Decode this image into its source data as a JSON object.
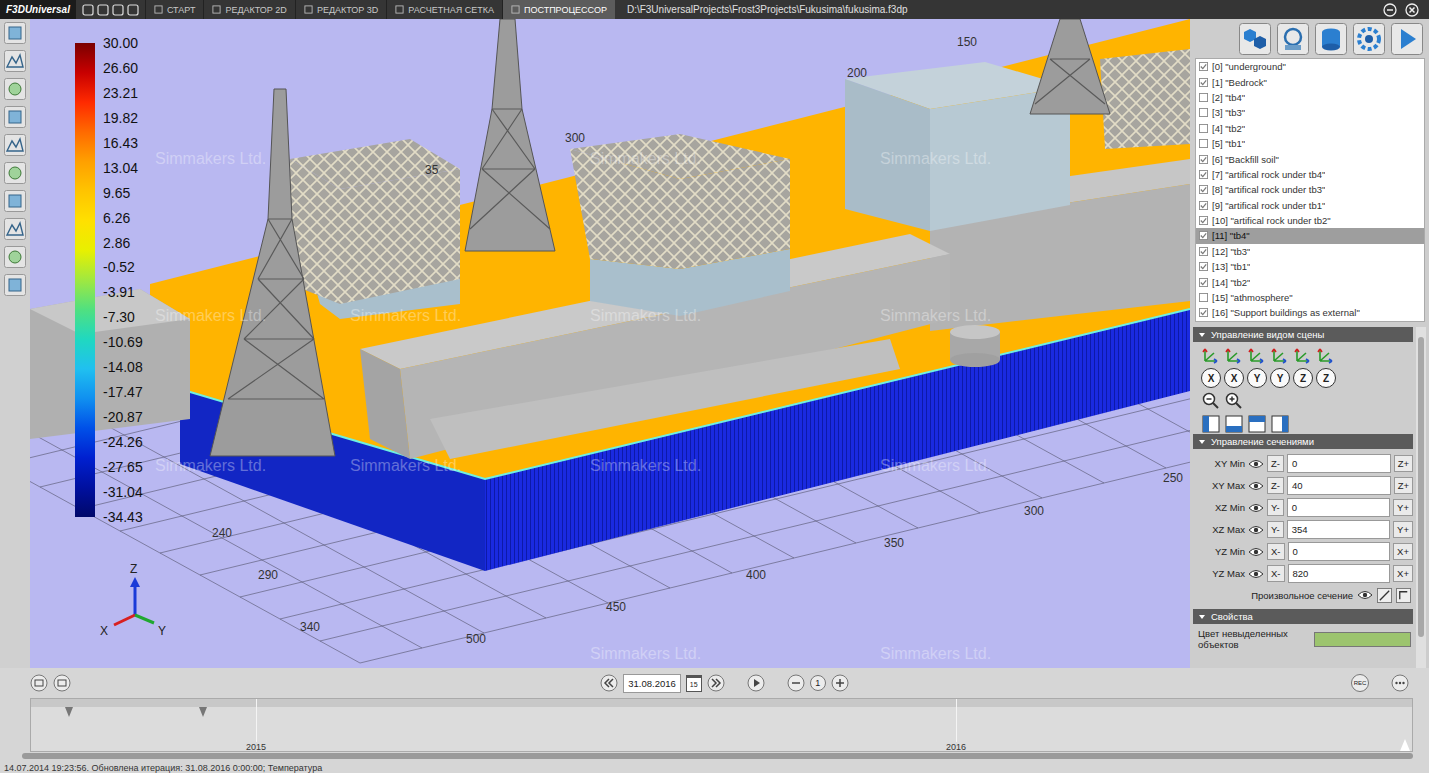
{
  "window": {
    "logo": "F3DUniversal",
    "path": "D:\\F3UniversalProjects\\Frost3Projects\\Fukusima\\fukusima.f3dp"
  },
  "tabs": [
    {
      "label": "СТАРТ",
      "selected": false
    },
    {
      "label": "РЕДАКТОР 2D",
      "selected": false
    },
    {
      "label": "РЕДАКТОР 3D",
      "selected": false
    },
    {
      "label": "РАСЧЕТНАЯ СЕТКА",
      "selected": false
    },
    {
      "label": "ПОСТПРОЦЕССОР",
      "selected": true
    }
  ],
  "legend": {
    "ticks": [
      "30.00",
      "26.60",
      "23.21",
      "19.82",
      "16.43",
      "13.04",
      "9.65",
      "6.26",
      "2.86",
      "-0.52",
      "-3.91",
      "-7.30",
      "-10.69",
      "-14.08",
      "-17.47",
      "-20.87",
      "-24.26",
      "-27.65",
      "-31.04",
      "-34.43"
    ],
    "gradient": [
      "#7a0000",
      "#c80000",
      "#ff2a00",
      "#ff6a00",
      "#ffa000",
      "#ffc400",
      "#ffe000",
      "#e8f000",
      "#a0e840",
      "#50e080",
      "#20d8c0",
      "#20c0f0",
      "#1090f0",
      "#0050e8",
      "#0020d0",
      "#0010a0",
      "#00086a"
    ]
  },
  "viewport": {
    "watermark": "Simmakers Ltd.",
    "axis_labels": [
      "150",
      "200",
      "300",
      "35",
      "240",
      "290",
      "340",
      "500",
      "450",
      "400",
      "350",
      "300",
      "250"
    ],
    "triad": [
      "Z",
      "X",
      "Y"
    ]
  },
  "layers": [
    {
      "label": "[0] \"underground\"",
      "checked": true,
      "selected": false
    },
    {
      "label": "[1] \"Bedrock\"",
      "checked": true,
      "selected": false
    },
    {
      "label": "[2] \"tb4\"",
      "checked": false,
      "selected": false
    },
    {
      "label": "[3] \"tb3\"",
      "checked": false,
      "selected": false
    },
    {
      "label": "[4] \"tb2\"",
      "checked": false,
      "selected": false
    },
    {
      "label": "[5] \"tb1\"",
      "checked": false,
      "selected": false
    },
    {
      "label": "[6] \"Backfill soil\"",
      "checked": true,
      "selected": false
    },
    {
      "label": "[7] \"artifical rock under tb4\"",
      "checked": true,
      "selected": false
    },
    {
      "label": "[8] \"artifical rock under tb3\"",
      "checked": true,
      "selected": false
    },
    {
      "label": "[9] \"artifical rock under tb1\"",
      "checked": true,
      "selected": false
    },
    {
      "label": "[10] \"artifical rock under tb2\"",
      "checked": true,
      "selected": false
    },
    {
      "label": "[11] \"tb4\"",
      "checked": true,
      "selected": true
    },
    {
      "label": "[12] \"tb3\"",
      "checked": true,
      "selected": false
    },
    {
      "label": "[13] \"tb1\"",
      "checked": true,
      "selected": false
    },
    {
      "label": "[14] \"tb2\"",
      "checked": true,
      "selected": false
    },
    {
      "label": "[15] \"athmosphere\"",
      "checked": false,
      "selected": false
    },
    {
      "label": "[16] \"Support buildings as external\"",
      "checked": true,
      "selected": false
    }
  ],
  "view_panel": {
    "title": "Управление видом сцены",
    "rotate_labels": [
      "X",
      "X",
      "Y",
      "Y",
      "Z",
      "Z"
    ]
  },
  "sections_panel": {
    "title": "Управление сечениями",
    "rows": [
      {
        "label": "XY Min",
        "minus": "Z-",
        "value": "0",
        "plus": "Z+"
      },
      {
        "label": "XY Max",
        "minus": "Z-",
        "value": "40",
        "plus": "Z+"
      },
      {
        "label": "XZ Min",
        "minus": "Y-",
        "value": "0",
        "plus": "Y+"
      },
      {
        "label": "XZ Max",
        "minus": "Y-",
        "value": "354",
        "plus": "Y+"
      },
      {
        "label": "YZ Min",
        "minus": "X-",
        "value": "0",
        "plus": "X+"
      },
      {
        "label": "YZ Max",
        "minus": "X-",
        "value": "820",
        "plus": "X+"
      }
    ],
    "arbitrary": "Произвольное сечение"
  },
  "properties": {
    "title": "Свойства",
    "label": "Цвет невыделенных объектов",
    "color": "#9cc46e"
  },
  "timeline": {
    "date": "31.08.2016",
    "calendar_day": "15",
    "step": "1",
    "rec": "REC",
    "years": [
      "2015",
      "2016"
    ]
  },
  "status_bar": "14.07.2014 19:23:56. Обновлена итерация: 31.08.2016 0:00:00; Температура"
}
